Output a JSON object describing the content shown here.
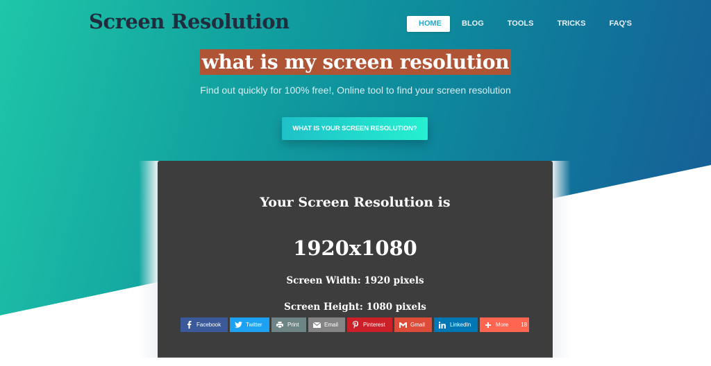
{
  "header": {
    "logo": "Screen Resolution",
    "nav": [
      {
        "label": "HOME",
        "active": true
      },
      {
        "label": "BLOG",
        "active": false
      },
      {
        "label": "TOOLS",
        "active": false
      },
      {
        "label": "TRICKS",
        "active": false
      },
      {
        "label": "FAQ'S",
        "active": false
      }
    ]
  },
  "hero": {
    "headline": "what is my screen resolution",
    "subtitle": "Find out quickly for 100% free!, Online tool to find your screen resolution",
    "cta_label": "WHAT IS YOUR SCREEN RESOLUTION?"
  },
  "result_card": {
    "title": "Your Screen Resolution is",
    "resolution": "1920x1080",
    "width_text": "Screen Width: 1920 pixels",
    "height_text": "Screen Height: 1080 pixels"
  },
  "share": [
    {
      "label": "Facebook",
      "icon": "facebook-icon",
      "color": "#3b5998"
    },
    {
      "label": "Twitter",
      "icon": "twitter-icon",
      "color": "#1da1f2"
    },
    {
      "label": "Print",
      "icon": "print-icon",
      "color": "#6d8584"
    },
    {
      "label": "Email",
      "icon": "email-icon",
      "color": "#848484"
    },
    {
      "label": "Pinterest",
      "icon": "pinterest-icon",
      "color": "#cb2027"
    },
    {
      "label": "Gmail",
      "icon": "gmail-icon",
      "color": "#dd4b39"
    },
    {
      "label": "LinkedIn",
      "icon": "linkedin-icon",
      "color": "#0077b5"
    },
    {
      "label": "More",
      "icon": "plus-icon",
      "color": "#ff6550",
      "count": "18"
    }
  ],
  "colors": {
    "headline_bg": "#b05436",
    "card_bg": "#3d3d3d",
    "nav_active_text": "#22a9c9",
    "logo_text": "#1f2d3d"
  }
}
